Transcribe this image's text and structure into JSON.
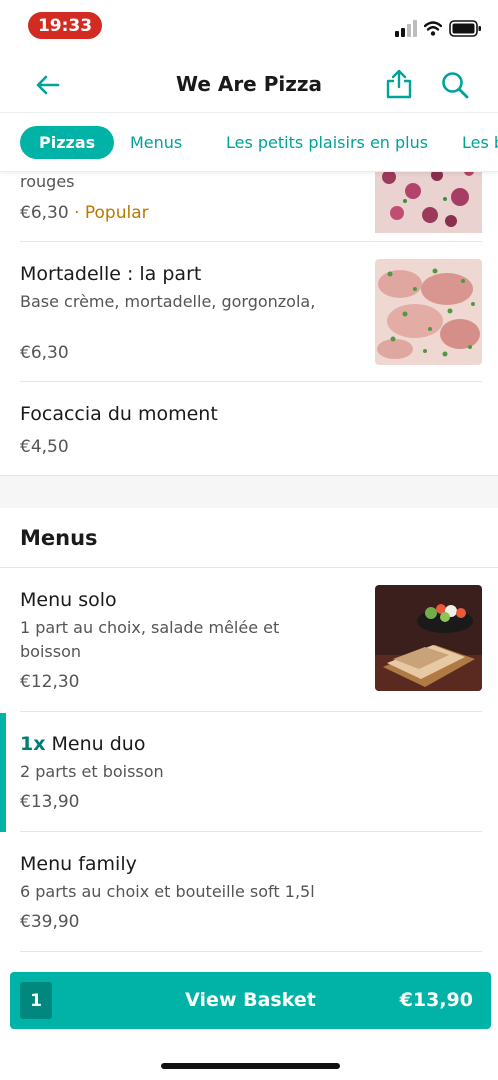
{
  "status_bar": {
    "time": "19:33"
  },
  "header": {
    "title": "We Are Pizza"
  },
  "tabs": [
    {
      "label": "Pizzas"
    },
    {
      "label": "Menus"
    },
    {
      "label": "Les petits plaisirs en plus"
    },
    {
      "label": "Les b"
    }
  ],
  "pizzas": [
    {
      "name_fragment": "rouges",
      "price": "€6,30",
      "tag_sep": " · ",
      "tag": "Popular"
    },
    {
      "name": "Mortadelle : la part",
      "description": "Base crème, mortadelle, gorgonzola,",
      "price": "€6,30"
    },
    {
      "name": "Focaccia du moment",
      "price": "€4,50"
    }
  ],
  "menus_section": {
    "title": "Menus",
    "items": [
      {
        "name": "Menu solo",
        "description_line1": "1 part au choix, salade mêlée et",
        "description_line2": "boisson",
        "price": "€12,30"
      },
      {
        "quantity": "1x",
        "name": "Menu duo",
        "description": "2 parts et boisson",
        "price": "€13,90"
      },
      {
        "name": "Menu family",
        "description": "6 parts au choix et bouteille soft 1,5l",
        "price": "€39,90"
      }
    ]
  },
  "basket": {
    "count": "1",
    "label": "View Basket",
    "total": "€13,90"
  },
  "colors": {
    "accent": "#00b3a6",
    "accent_dark": "#00877e",
    "popular": "#b97a00",
    "status_time_bg": "#d12b22"
  }
}
